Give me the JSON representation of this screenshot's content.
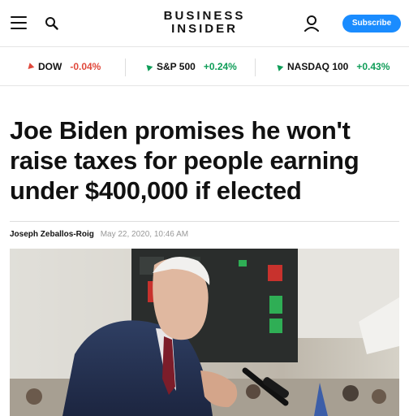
{
  "header": {
    "logo_line1": "BUSINESS",
    "logo_line2": "INSIDER",
    "subscribe_label": "Subscribe"
  },
  "ticker": [
    {
      "name": "DOW",
      "change": "-0.04%",
      "direction": "down"
    },
    {
      "name": "S&P 500",
      "change": "+0.24%",
      "direction": "up"
    },
    {
      "name": "NASDAQ 100",
      "change": "+0.43%",
      "direction": "up"
    }
  ],
  "article": {
    "headline_lines": [
      "Joe Biden promises he won't",
      "raise taxes for people earning",
      "under $400,000 if elected"
    ],
    "author": "Joseph Zeballos-Roig",
    "date": "May 22, 2020, 10:46 AM"
  },
  "colors": {
    "accent": "#1a8cff",
    "negative": "#e0483b",
    "positive": "#0f9d58"
  }
}
